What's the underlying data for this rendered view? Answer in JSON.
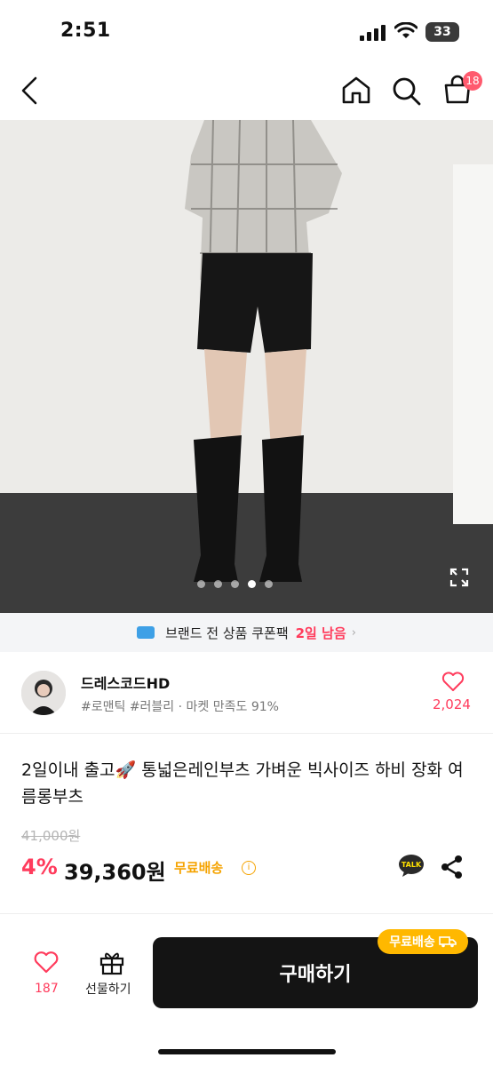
{
  "status_bar": {
    "time": "2:51",
    "battery": "33"
  },
  "nav": {
    "cart_count": "18"
  },
  "image": {
    "slide_count": 5,
    "active_slide": 4
  },
  "coupon": {
    "text": "브랜드 전 상품 쿠폰팩",
    "days_left": "2일 남음"
  },
  "seller": {
    "name": "드레스코드HD",
    "tags": "#로맨틱 #러블리 · 마켓 만족도 91%",
    "like_count": "2,024"
  },
  "product": {
    "title": "2일이내 출고🚀 통넓은레인부츠 가벼운 빅사이즈 하비 장화 여름롱부츠",
    "original_price": "41,000원",
    "discount_rate": "4%",
    "sale_price": "39,360원",
    "shipping": "무료배송"
  },
  "bottom_bar": {
    "like_count": "187",
    "gift_label": "선물하기",
    "buy_label": "구매하기",
    "shipping_pill": "무료배송"
  },
  "colors": {
    "accent": "#ff3b5c",
    "shipping": "#f5a300",
    "buy_button": "#141414"
  }
}
